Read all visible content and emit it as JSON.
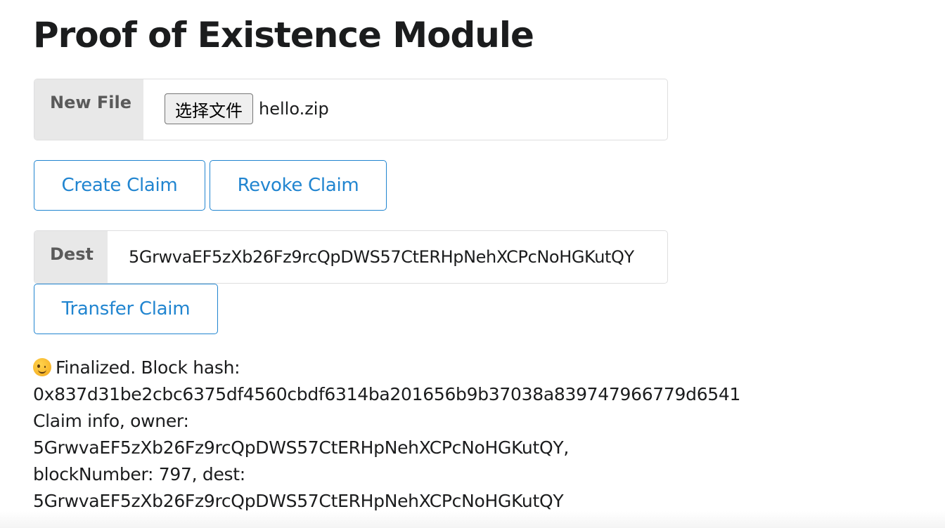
{
  "page": {
    "title": "Proof of Existence Module"
  },
  "file_row": {
    "label": "New File",
    "button_label": "选择文件",
    "file_name": "hello.zip"
  },
  "claim_buttons": {
    "create": "Create Claim",
    "revoke": "Revoke Claim"
  },
  "dest_row": {
    "label": "Dest",
    "value": "5GrwvaEF5zXb26Fz9rcQpDWS57CtERHpNehXCPcNoHGKutQY"
  },
  "transfer_button": "Transfer Claim",
  "status": {
    "icon": "winking-face-emoji",
    "line1": "Finalized. Block hash:",
    "line2": "0x837d31be2cbc6375df4560cbdf6314ba201656b9b37038a839747966779d6541",
    "line3": "Claim info, owner:",
    "line4": "5GrwvaEF5zXb26Fz9rcQpDWS57CtERHpNehXCPcNoHGKutQY,",
    "line5": "blockNumber: 797, dest:",
    "line6": "5GrwvaEF5zXb26Fz9rcQpDWS57CtERHpNehXCPcNoHGKutQY"
  },
  "colors": {
    "primary": "#2185d0",
    "label_bg": "#e8e8e8",
    "text": "#1b1c1d"
  }
}
